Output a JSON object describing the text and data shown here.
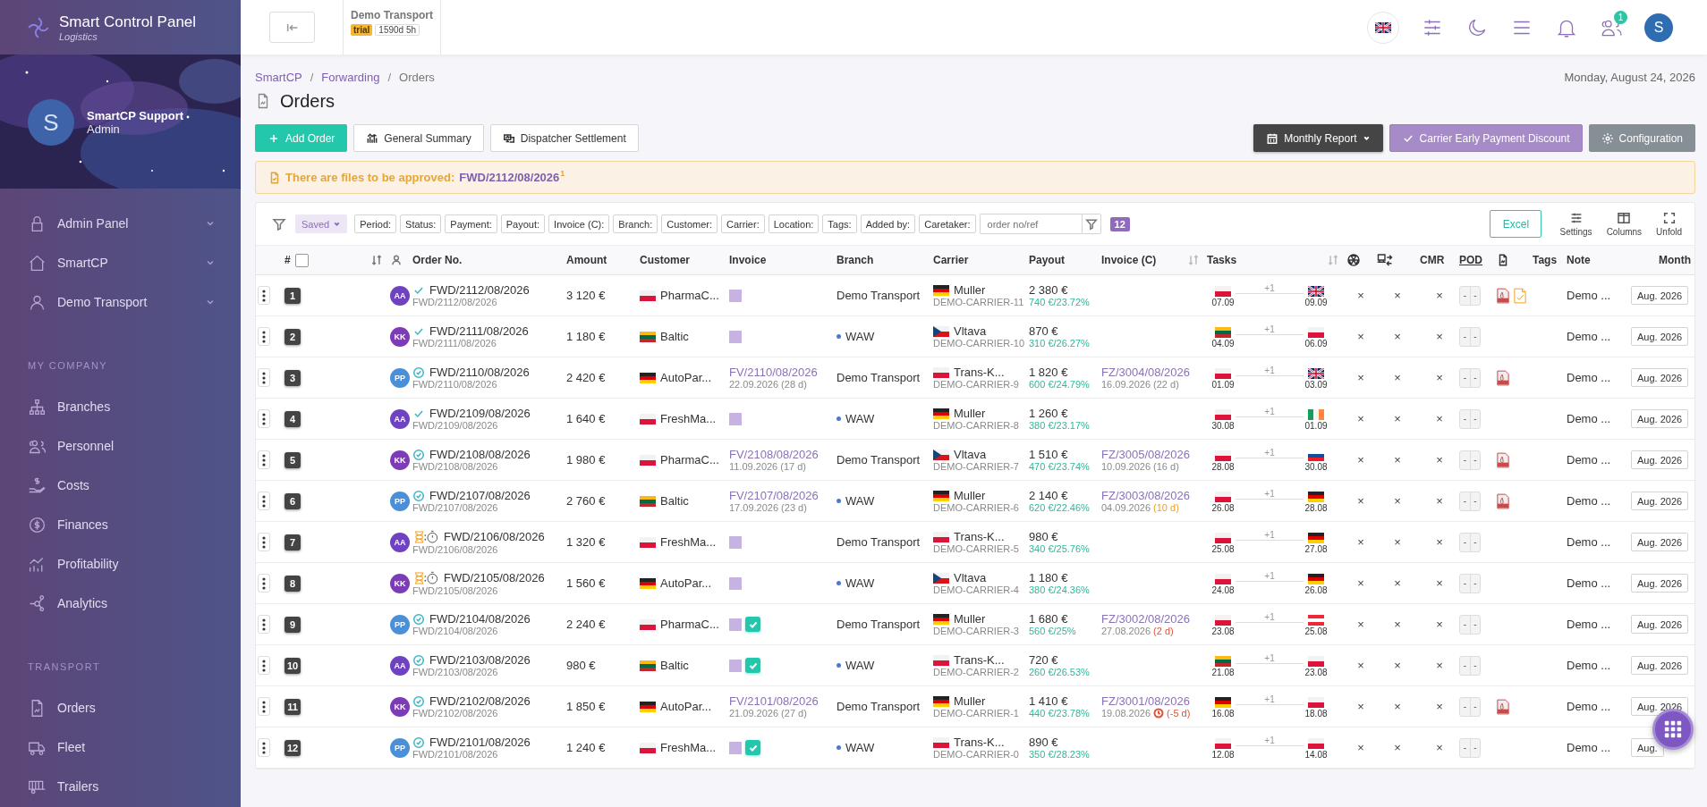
{
  "sidebar": {
    "brand": {
      "name": "Smart Control Panel",
      "tagline": "Logistics"
    },
    "profile": {
      "initial": "S",
      "name": "SmartCP Support",
      "role": "Admin"
    },
    "nav": [
      {
        "label": "Admin Panel",
        "kind": "lock",
        "submenu": true
      },
      {
        "label": "SmartCP",
        "kind": "home",
        "submenu": true
      },
      {
        "label": "Demo Transport",
        "kind": "user",
        "submenu": true
      }
    ],
    "sections": [
      {
        "title": "MY COMPANY",
        "items": [
          {
            "label": "Branches",
            "kind": "sitemap"
          },
          {
            "label": "Personnel",
            "kind": "users"
          },
          {
            "label": "Costs",
            "kind": "hand"
          },
          {
            "label": "Finances",
            "kind": "dollar"
          },
          {
            "label": "Profitability",
            "kind": "chart"
          },
          {
            "label": "Analytics",
            "kind": "nodes"
          }
        ]
      },
      {
        "title": "TRANSPORT",
        "items": [
          {
            "label": "Orders",
            "kind": "file"
          },
          {
            "label": "Fleet",
            "kind": "truck"
          },
          {
            "label": "Trailers",
            "kind": "trailer"
          }
        ]
      }
    ]
  },
  "topbar": {
    "company": "Demo Transport",
    "plan": "trial",
    "remaining": "1590d 5h",
    "language": {
      "kind": "gb"
    },
    "team_badge": "1",
    "user_initial": "S"
  },
  "breadcrumb": [
    "SmartCP",
    "Forwarding",
    "Orders"
  ],
  "breadcrumb_separators": [
    "/",
    "/"
  ],
  "date": "Monday, August 24, 2026",
  "title": "Orders",
  "actions_left": [
    {
      "label": "Add Order",
      "kind": "add"
    },
    {
      "label": "General Summary",
      "kind": "summary"
    },
    {
      "label": "Dispatcher Settlement",
      "kind": "dispatch"
    }
  ],
  "actions_right": [
    {
      "label": "Monthly Report",
      "kind": "report"
    },
    {
      "label": "Carrier Early Payment Discount",
      "kind": "discount"
    },
    {
      "label": "Configuration",
      "kind": "config"
    }
  ],
  "alert": {
    "text": "There are files to be approved:",
    "link": "FWD/2112/08/2026",
    "count": "1"
  },
  "filters": {
    "saved": "Saved",
    "chips": [
      "Period:",
      "Status:",
      "Payment:",
      "Payout:",
      "Invoice (C):",
      "Branch:",
      "Customer:",
      "Carrier:",
      "Location:",
      "Tags:",
      "Added by:",
      "Caretaker:"
    ],
    "search_placeholder": "order no/ref",
    "count": "12",
    "tools": [
      {
        "label": "Excel",
        "kind": "excel"
      },
      {
        "label": "Settings",
        "kind": "settings"
      },
      {
        "label": "Columns",
        "kind": "columns"
      },
      {
        "label": "Unfold",
        "kind": "unfold"
      }
    ]
  },
  "table": {
    "columns": [
      "#",
      "Order No.",
      "Amount",
      "Customer",
      "Invoice",
      "Branch",
      "Carrier",
      "Payout",
      "Invoice (C)",
      "Tasks",
      "CMR",
      "POD",
      "Tags",
      "Note",
      "Month"
    ],
    "select_all": {
      "checked": false
    },
    "rows": [
      {
        "num": "1",
        "avatar": {
          "initials": "AA",
          "color": "#6f42c1"
        },
        "status": {
          "kind": "check"
        },
        "order_no": "FWD/2112/08/2026",
        "order_ref": "FWD/2112/08/2026",
        "amount": "3 120 €",
        "customer": {
          "flag": {
            "kind": "pl"
          },
          "name": "PharmaC..."
        },
        "invoice": {
          "kind": "draft",
          "approved": false
        },
        "branch": {
          "kind": "company",
          "name": "Demo Transport"
        },
        "carrier": {
          "flag": {
            "kind": "de"
          },
          "name": "Muller",
          "code": "DEMO-CARRIER-11"
        },
        "payout": "2 380 €",
        "margin": "740 €/23.72%",
        "tasks": {
          "from": {
            "flag": {
              "kind": "pl"
            },
            "date": "07.09"
          },
          "extra": "+1",
          "to": {
            "flag": {
              "kind": "gb"
            },
            "date": "09.09"
          }
        },
        "marks": [
          "×",
          "×",
          "×"
        ],
        "pod": [
          "-",
          "-"
        ],
        "pdf": true,
        "file_pending": true,
        "note": "Demo ...",
        "month": "Aug. 2026"
      },
      {
        "num": "2",
        "avatar": {
          "initials": "KK",
          "color": "#7e3bb8"
        },
        "status": {
          "kind": "check"
        },
        "order_no": "FWD/2111/08/2026",
        "order_ref": "FWD/2111/08/2026",
        "amount": "1 180 €",
        "customer": {
          "flag": {
            "kind": "lt"
          },
          "name": "Baltic"
        },
        "invoice": {
          "kind": "draft",
          "approved": false
        },
        "branch": {
          "kind": "location",
          "name": "WAW"
        },
        "carrier": {
          "flag": {
            "kind": "cz"
          },
          "name": "Vltava",
          "code": "DEMO-CARRIER-10"
        },
        "payout": "870 €",
        "margin": "310 €/26.27%",
        "tasks": {
          "from": {
            "flag": {
              "kind": "lt"
            },
            "date": "04.09"
          },
          "extra": "+1",
          "to": {
            "flag": {
              "kind": "pl"
            },
            "date": "06.09"
          }
        },
        "marks": [
          "×",
          "×",
          "×"
        ],
        "pod": [
          "-",
          "-"
        ],
        "pdf": false,
        "file_pending": false,
        "note": "Demo ...",
        "month": "Aug. 2026"
      },
      {
        "num": "3",
        "avatar": {
          "initials": "PP",
          "color": "#4a8fd8"
        },
        "status": {
          "kind": "verified"
        },
        "order_no": "FWD/2110/08/2026",
        "order_ref": "FWD/2110/08/2026",
        "amount": "2 420 €",
        "customer": {
          "flag": {
            "kind": "de"
          },
          "name": "AutoPar..."
        },
        "invoice": {
          "kind": "issued",
          "number": "FV/2110/08/2026",
          "date": "22.09.2026",
          "term": "(28 d)"
        },
        "branch": {
          "kind": "company",
          "name": "Demo Transport"
        },
        "carrier": {
          "flag": {
            "kind": "pl"
          },
          "name": "Trans-K...",
          "code": "DEMO-CARRIER-9"
        },
        "payout": "1 820 €",
        "margin": "600 €/24.79%",
        "invoice_c": {
          "number": "FZ/3004/08/2026",
          "date": "16.09.2026",
          "term": "(22 d)",
          "kind": "normal",
          "late": false
        },
        "tasks": {
          "from": {
            "flag": {
              "kind": "pl"
            },
            "date": "01.09"
          },
          "extra": "+1",
          "to": {
            "flag": {
              "kind": "gb"
            },
            "date": "03.09"
          }
        },
        "marks": [
          "×",
          "×",
          "×"
        ],
        "pod": [
          "-",
          "-"
        ],
        "pdf": true,
        "file_pending": false,
        "note": "Demo ...",
        "month": "Aug. 2026"
      },
      {
        "num": "4",
        "avatar": {
          "initials": "AA",
          "color": "#6f42c1"
        },
        "status": {
          "kind": "check"
        },
        "order_no": "FWD/2109/08/2026",
        "order_ref": "FWD/2109/08/2026",
        "amount": "1 640 €",
        "customer": {
          "flag": {
            "kind": "pl"
          },
          "name": "FreshMa..."
        },
        "invoice": {
          "kind": "draft",
          "approved": false
        },
        "branch": {
          "kind": "location",
          "name": "WAW"
        },
        "carrier": {
          "flag": {
            "kind": "de"
          },
          "name": "Muller",
          "code": "DEMO-CARRIER-8"
        },
        "payout": "1 260 €",
        "margin": "380 €/23.17%",
        "tasks": {
          "from": {
            "flag": {
              "kind": "pl"
            },
            "date": "30.08"
          },
          "extra": "+1",
          "to": {
            "flag": {
              "kind": "ie"
            },
            "date": "01.09"
          }
        },
        "marks": [
          "×",
          "×",
          "×"
        ],
        "pod": [
          "-",
          "-"
        ],
        "pdf": false,
        "file_pending": false,
        "note": "Demo ...",
        "month": "Aug. 2026"
      },
      {
        "num": "5",
        "avatar": {
          "initials": "KK",
          "color": "#7e3bb8"
        },
        "status": {
          "kind": "verified"
        },
        "order_no": "FWD/2108/08/2026",
        "order_ref": "FWD/2108/08/2026",
        "amount": "1 980 €",
        "customer": {
          "flag": {
            "kind": "pl"
          },
          "name": "PharmaC..."
        },
        "invoice": {
          "kind": "issued",
          "number": "FV/2108/08/2026",
          "date": "11.09.2026",
          "term": "(17 d)"
        },
        "branch": {
          "kind": "company",
          "name": "Demo Transport"
        },
        "carrier": {
          "flag": {
            "kind": "cz"
          },
          "name": "Vltava",
          "code": "DEMO-CARRIER-7"
        },
        "payout": "1 510 €",
        "margin": "470 €/23.74%",
        "invoice_c": {
          "number": "FZ/3005/08/2026",
          "date": "10.09.2026",
          "term": "(16 d)",
          "kind": "normal",
          "late": false
        },
        "tasks": {
          "from": {
            "flag": {
              "kind": "pl"
            },
            "date": "28.08"
          },
          "extra": "+1",
          "to": {
            "flag": {
              "kind": "sk"
            },
            "date": "30.08"
          }
        },
        "marks": [
          "×",
          "×",
          "×"
        ],
        "pod": [
          "-",
          "-"
        ],
        "pdf": true,
        "file_pending": false,
        "note": "Demo ...",
        "month": "Aug. 2026"
      },
      {
        "num": "6",
        "avatar": {
          "initials": "PP",
          "color": "#4a8fd8"
        },
        "status": {
          "kind": "verified"
        },
        "order_no": "FWD/2107/08/2026",
        "order_ref": "FWD/2107/08/2026",
        "amount": "2 760 €",
        "customer": {
          "flag": {
            "kind": "lt"
          },
          "name": "Baltic"
        },
        "invoice": {
          "kind": "issued",
          "number": "FV/2107/08/2026",
          "date": "17.09.2026",
          "term": "(23 d)"
        },
        "branch": {
          "kind": "location",
          "name": "WAW"
        },
        "carrier": {
          "flag": {
            "kind": "de"
          },
          "name": "Muller",
          "code": "DEMO-CARRIER-6"
        },
        "payout": "2 140 €",
        "margin": "620 €/22.46%",
        "invoice_c": {
          "number": "FZ/3003/08/2026",
          "date": "04.09.2026",
          "term": "(10 d)",
          "kind": "soon",
          "late": false
        },
        "tasks": {
          "from": {
            "flag": {
              "kind": "pl"
            },
            "date": "26.08"
          },
          "extra": "+1",
          "to": {
            "flag": {
              "kind": "de"
            },
            "date": "28.08"
          }
        },
        "marks": [
          "×",
          "×",
          "×"
        ],
        "pod": [
          "-",
          "-"
        ],
        "pdf": true,
        "file_pending": false,
        "note": "Demo ...",
        "month": "Aug. 2026"
      },
      {
        "num": "7",
        "avatar": {
          "initials": "AA",
          "color": "#6f42c1"
        },
        "status": {
          "kind": "waiting"
        },
        "order_no": "FWD/2106/08/2026",
        "order_ref": "FWD/2106/08/2026",
        "amount": "1 320 €",
        "customer": {
          "flag": {
            "kind": "pl"
          },
          "name": "FreshMa..."
        },
        "invoice": {
          "kind": "draft",
          "approved": false
        },
        "branch": {
          "kind": "company",
          "name": "Demo Transport"
        },
        "carrier": {
          "flag": {
            "kind": "pl"
          },
          "name": "Trans-K...",
          "code": "DEMO-CARRIER-5"
        },
        "payout": "980 €",
        "margin": "340 €/25.76%",
        "tasks": {
          "from": {
            "flag": {
              "kind": "pl"
            },
            "date": "25.08"
          },
          "extra": "+1",
          "to": {
            "flag": {
              "kind": "de"
            },
            "date": "27.08"
          }
        },
        "marks": [
          "×",
          "×",
          "×"
        ],
        "pod": [
          "-",
          "-"
        ],
        "pdf": false,
        "file_pending": false,
        "note": "Demo ...",
        "month": "Aug. 2026"
      },
      {
        "num": "8",
        "avatar": {
          "initials": "KK",
          "color": "#7e3bb8"
        },
        "status": {
          "kind": "waiting"
        },
        "order_no": "FWD/2105/08/2026",
        "order_ref": "FWD/2105/08/2026",
        "amount": "1 560 €",
        "customer": {
          "flag": {
            "kind": "de"
          },
          "name": "AutoPar..."
        },
        "invoice": {
          "kind": "draft",
          "approved": false
        },
        "branch": {
          "kind": "location",
          "name": "WAW"
        },
        "carrier": {
          "flag": {
            "kind": "cz"
          },
          "name": "Vltava",
          "code": "DEMO-CARRIER-4"
        },
        "payout": "1 180 €",
        "margin": "380 €/24.36%",
        "tasks": {
          "from": {
            "flag": {
              "kind": "pl"
            },
            "date": "24.08"
          },
          "extra": "+1",
          "to": {
            "flag": {
              "kind": "de"
            },
            "date": "26.08"
          }
        },
        "marks": [
          "×",
          "×",
          "×"
        ],
        "pod": [
          "-",
          "-"
        ],
        "pdf": false,
        "file_pending": false,
        "note": "Demo ...",
        "month": "Aug. 2026"
      },
      {
        "num": "9",
        "avatar": {
          "initials": "PP",
          "color": "#4a8fd8"
        },
        "status": {
          "kind": "verified"
        },
        "order_no": "FWD/2104/08/2026",
        "order_ref": "FWD/2104/08/2026",
        "amount": "2 240 €",
        "customer": {
          "flag": {
            "kind": "pl"
          },
          "name": "PharmaC..."
        },
        "invoice": {
          "kind": "draft",
          "approved": true
        },
        "branch": {
          "kind": "company",
          "name": "Demo Transport"
        },
        "carrier": {
          "flag": {
            "kind": "de"
          },
          "name": "Muller",
          "code": "DEMO-CARRIER-3"
        },
        "payout": "1 680 €",
        "margin": "560 €/25%",
        "invoice_c": {
          "number": "FZ/3002/08/2026",
          "date": "27.08.2026",
          "term": "(2 d)",
          "kind": "overdue",
          "late": false
        },
        "tasks": {
          "from": {
            "flag": {
              "kind": "pl"
            },
            "date": "23.08"
          },
          "extra": "+1",
          "to": {
            "flag": {
              "kind": "at"
            },
            "date": "25.08"
          }
        },
        "marks": [
          "×",
          "×",
          "×"
        ],
        "pod": [
          "-",
          "-"
        ],
        "pdf": false,
        "file_pending": false,
        "note": "Demo ...",
        "month": "Aug. 2026"
      },
      {
        "num": "10",
        "avatar": {
          "initials": "AA",
          "color": "#6f42c1"
        },
        "status": {
          "kind": "verified"
        },
        "order_no": "FWD/2103/08/2026",
        "order_ref": "FWD/2103/08/2026",
        "amount": "980 €",
        "customer": {
          "flag": {
            "kind": "lt"
          },
          "name": "Baltic"
        },
        "invoice": {
          "kind": "draft",
          "approved": true
        },
        "branch": {
          "kind": "location",
          "name": "WAW"
        },
        "carrier": {
          "flag": {
            "kind": "pl"
          },
          "name": "Trans-K...",
          "code": "DEMO-CARRIER-2"
        },
        "payout": "720 €",
        "margin": "260 €/26.53%",
        "tasks": {
          "from": {
            "flag": {
              "kind": "lt"
            },
            "date": "21.08"
          },
          "extra": "+1",
          "to": {
            "flag": {
              "kind": "pl"
            },
            "date": "23.08"
          }
        },
        "marks": [
          "×",
          "×",
          "×"
        ],
        "pod": [
          "-",
          "-"
        ],
        "pdf": false,
        "file_pending": false,
        "note": "Demo ...",
        "month": "Aug. 2026"
      },
      {
        "num": "11",
        "avatar": {
          "initials": "KK",
          "color": "#7e3bb8"
        },
        "status": {
          "kind": "verified"
        },
        "order_no": "FWD/2102/08/2026",
        "order_ref": "FWD/2102/08/2026",
        "amount": "1 850 €",
        "customer": {
          "flag": {
            "kind": "de"
          },
          "name": "AutoPar..."
        },
        "invoice": {
          "kind": "issued",
          "number": "FV/2101/08/2026",
          "date": "21.09.2026",
          "term": "(27 d)"
        },
        "branch": {
          "kind": "company",
          "name": "Demo Transport"
        },
        "carrier": {
          "flag": {
            "kind": "de"
          },
          "name": "Muller",
          "code": "DEMO-CARRIER-1"
        },
        "payout": "1 410 €",
        "margin": "440 €/23.78%",
        "invoice_c": {
          "number": "FZ/3001/08/2026",
          "date": "19.08.2026",
          "term": "(-5 d)",
          "kind": "overdue",
          "late": true
        },
        "tasks": {
          "from": {
            "flag": {
              "kind": "de"
            },
            "date": "16.08"
          },
          "extra": "+1",
          "to": {
            "flag": {
              "kind": "pl"
            },
            "date": "18.08"
          }
        },
        "marks": [
          "×",
          "×",
          "×"
        ],
        "pod": [
          "-",
          "-"
        ],
        "pdf": true,
        "file_pending": false,
        "note": "Demo ...",
        "month": "Aug. 2026"
      },
      {
        "num": "12",
        "avatar": {
          "initials": "PP",
          "color": "#4a8fd8"
        },
        "status": {
          "kind": "verified"
        },
        "order_no": "FWD/2101/08/2026",
        "order_ref": "FWD/2101/08/2026",
        "amount": "1 240 €",
        "customer": {
          "flag": {
            "kind": "pl"
          },
          "name": "FreshMa..."
        },
        "invoice": {
          "kind": "draft",
          "approved": true
        },
        "branch": {
          "kind": "location",
          "name": "WAW"
        },
        "carrier": {
          "flag": {
            "kind": "pl"
          },
          "name": "Trans-K...",
          "code": "DEMO-CARRIER-0"
        },
        "payout": "890 €",
        "margin": "350 €/28.23%",
        "tasks": {
          "from": {
            "flag": {
              "kind": "pl"
            },
            "date": "12.08"
          },
          "extra": "+1",
          "to": {
            "flag": {
              "kind": "pl"
            },
            "date": "14.08"
          }
        },
        "marks": [
          "×",
          "×",
          "×"
        ],
        "pod": [
          "-",
          "-"
        ],
        "pdf": false,
        "file_pending": false,
        "note": "Demo ...",
        "month": "Aug."
      }
    ]
  }
}
